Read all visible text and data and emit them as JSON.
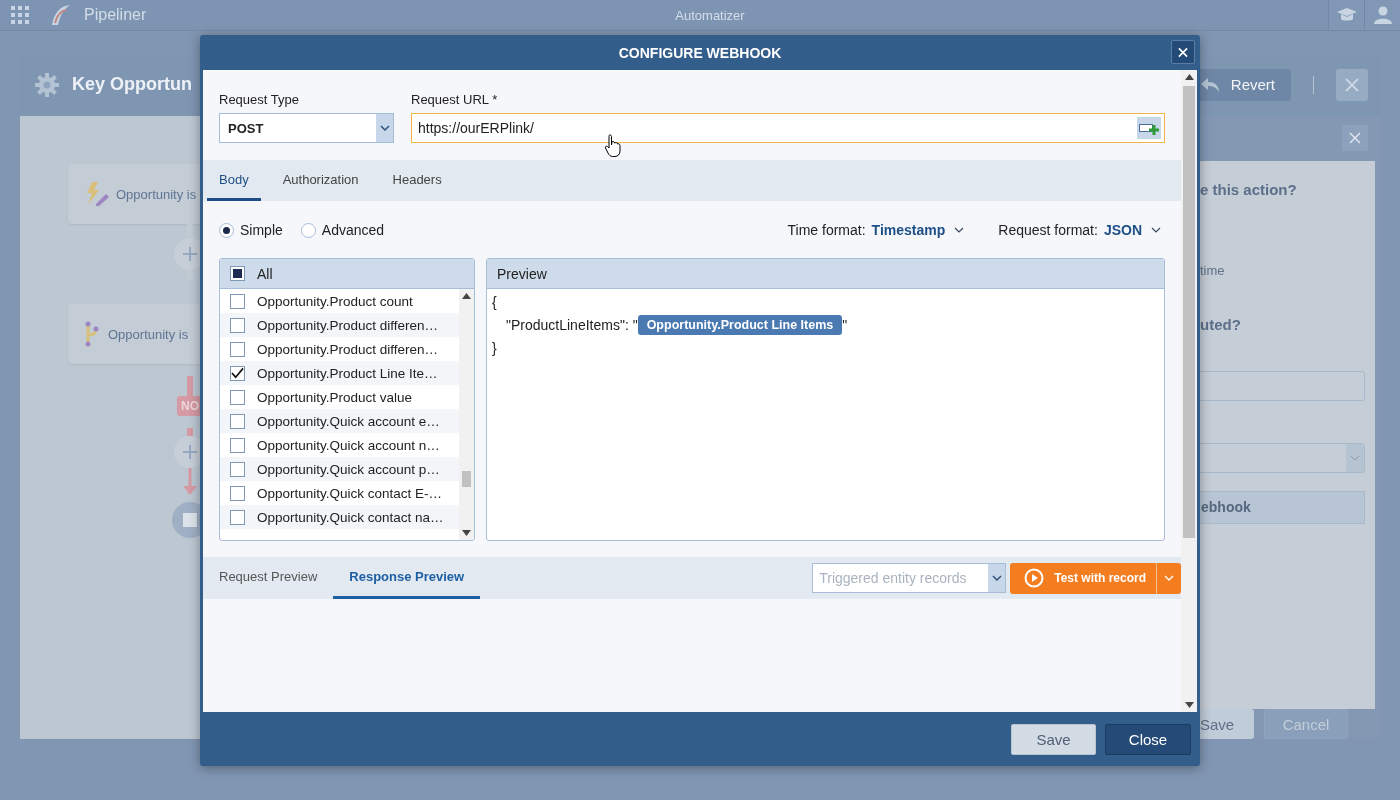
{
  "app_bar": {
    "logo": "Pipeliner",
    "title": "Automatizer"
  },
  "automation": {
    "title": "Key Opportun",
    "revert": "Revert"
  },
  "flow_nodes": [
    {
      "kind": "trigger",
      "label": "Opportunity is"
    },
    {
      "kind": "condition",
      "label": "Opportunity is"
    }
  ],
  "branch_label": "NO",
  "side_panel": {
    "question_1": "e this action?",
    "option": "time",
    "question_2": "uted?",
    "button": "ebhook",
    "buttons": [
      "Save",
      "Cancel"
    ]
  },
  "dialog": {
    "title": "CONFIGURE WEBHOOK",
    "request_type": {
      "label": "Request Type",
      "value": "POST"
    },
    "request_url": {
      "label": "Request URL *",
      "value": "https://ourERPlink/"
    },
    "tabs": [
      {
        "label": "Body",
        "selected": true
      },
      {
        "label": "Authorization",
        "selected": false
      },
      {
        "label": "Headers",
        "selected": false
      }
    ],
    "modes": [
      {
        "label": "Simple",
        "selected": true
      },
      {
        "label": "Advanced",
        "selected": false
      }
    ],
    "time_format": {
      "label": "Time format:",
      "value": "Timestamp"
    },
    "request_format": {
      "label": "Request format:",
      "value": "JSON"
    },
    "fields": {
      "all_label": "All",
      "all_partial": true,
      "items": [
        {
          "label": "Opportunity.Product count",
          "checked": false
        },
        {
          "label": "Opportunity.Product differen…",
          "checked": false
        },
        {
          "label": "Opportunity.Product differen…",
          "checked": false
        },
        {
          "label": "Opportunity.Product Line Ite…",
          "checked": true
        },
        {
          "label": "Opportunity.Product value",
          "checked": false
        },
        {
          "label": "Opportunity.Quick account e…",
          "checked": false
        },
        {
          "label": "Opportunity.Quick account n…",
          "checked": false
        },
        {
          "label": "Opportunity.Quick account p…",
          "checked": false
        },
        {
          "label": "Opportunity.Quick contact E-…",
          "checked": false
        },
        {
          "label": "Opportunity.Quick contact na…",
          "checked": false
        }
      ]
    },
    "preview": {
      "title": "Preview",
      "open": "{",
      "key": "\"ProductLineItems\": \"",
      "token": "Opportunity.Product Line Items",
      "quote": "\"",
      "close": "}"
    },
    "result_tabs": [
      {
        "label": "Request Preview",
        "selected": false
      },
      {
        "label": "Response Preview",
        "selected": true
      }
    ],
    "record_picker": {
      "placeholder": "Triggered entity records"
    },
    "test_button": "Test with record",
    "buttons": [
      {
        "label": "Save",
        "kind": "secondary"
      },
      {
        "label": "Close",
        "kind": "primary"
      }
    ]
  }
}
